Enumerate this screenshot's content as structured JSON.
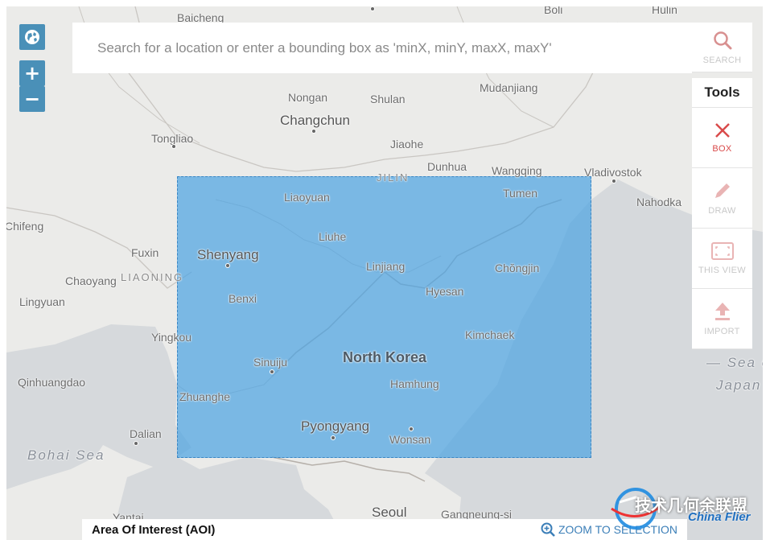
{
  "map": {
    "place_labels": [
      {
        "id": "baicheng",
        "text": "Baicheng"
      },
      {
        "id": "boli",
        "text": "Boli"
      },
      {
        "id": "hulin",
        "text": "Hulin"
      },
      {
        "id": "nongan",
        "text": "Nongan"
      },
      {
        "id": "shulan",
        "text": "Shulan"
      },
      {
        "id": "mudanjiang",
        "text": "Mudanjiang"
      },
      {
        "id": "changchun",
        "text": "Changchun"
      },
      {
        "id": "tongliao",
        "text": "Tongliao"
      },
      {
        "id": "jiaohe",
        "text": "Jiaohe"
      },
      {
        "id": "dunhua",
        "text": "Dunhua"
      },
      {
        "id": "wangqing",
        "text": "Wangqing"
      },
      {
        "id": "vladivostok",
        "text": "Vladivostok"
      },
      {
        "id": "jilin",
        "text": "JILIN"
      },
      {
        "id": "liaoyuan",
        "text": "Liaoyuan"
      },
      {
        "id": "tumen",
        "text": "Tumen"
      },
      {
        "id": "nahodka",
        "text": "Nahodka"
      },
      {
        "id": "chifeng",
        "text": "Chifeng"
      },
      {
        "id": "liuhe",
        "text": "Liuhe"
      },
      {
        "id": "fuxin",
        "text": "Fuxin"
      },
      {
        "id": "shenyang",
        "text": "Shenyang"
      },
      {
        "id": "linjiang",
        "text": "Linjiang"
      },
      {
        "id": "chongjin",
        "text": "Chŏngjin"
      },
      {
        "id": "chaoyang",
        "text": "Chaoyang"
      },
      {
        "id": "liaoning",
        "text": "LIAONING"
      },
      {
        "id": "hyesan",
        "text": "Hyesan"
      },
      {
        "id": "lingyuan",
        "text": "Lingyuan"
      },
      {
        "id": "benxi",
        "text": "Benxi"
      },
      {
        "id": "yingkou",
        "text": "Yingkou"
      },
      {
        "id": "kimchaek",
        "text": "Kimchaek"
      },
      {
        "id": "sinuiju",
        "text": "Sinuiju"
      },
      {
        "id": "north_korea",
        "text": "North Korea"
      },
      {
        "id": "qinhuangdao",
        "text": "Qinhuangdao"
      },
      {
        "id": "hamhung",
        "text": "Hamhung"
      },
      {
        "id": "sea_of_japan",
        "text": "— Sea o"
      },
      {
        "id": "japan",
        "text": "Japan"
      },
      {
        "id": "zhuanghe",
        "text": "Zhuanghe"
      },
      {
        "id": "pyongyang",
        "text": "Pyongyang"
      },
      {
        "id": "dalian",
        "text": "Dalian"
      },
      {
        "id": "wonsan",
        "text": "Wonsan"
      },
      {
        "id": "bohai_sea",
        "text": "Bohai Sea"
      },
      {
        "id": "yantai",
        "text": "Yantai"
      },
      {
        "id": "seoul",
        "text": "Seoul"
      },
      {
        "id": "gangneung",
        "text": "Gangneung-si"
      }
    ]
  },
  "controls": {
    "globe_icon": "globe-icon",
    "zoom_in": "+",
    "zoom_out": "−"
  },
  "search": {
    "placeholder": "Search for a location or enter a bounding box as 'minX, minY, maxX, maxY'",
    "button_label": "SEARCH"
  },
  "tools": {
    "heading": "Tools",
    "items": [
      {
        "label": "BOX",
        "icon": "close-x-icon",
        "active": true
      },
      {
        "label": "DRAW",
        "icon": "pencil-icon",
        "active": false
      },
      {
        "label": "THIS VIEW",
        "icon": "frame-icon",
        "active": false
      },
      {
        "label": "IMPORT",
        "icon": "upload-icon",
        "active": false
      }
    ]
  },
  "bottom_bar": {
    "title": "Area Of Interest (AOI)",
    "zoom_to_selection": "ZOOM TO SELECTION"
  },
  "watermark": {
    "line1": "技术几何余联盟",
    "line2": "China Flier"
  },
  "colors": {
    "aoi_fill": "#4da4e2",
    "control_bg": "#4a90b8",
    "active_tool": "#d94a4a",
    "link": "#3c7fb8"
  }
}
